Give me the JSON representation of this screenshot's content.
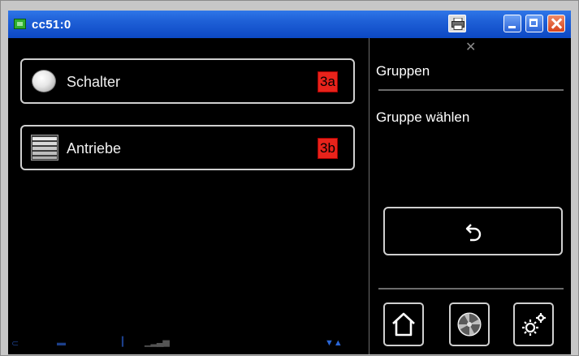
{
  "window": {
    "title": "cc51:0",
    "icons": {
      "app": "app-icon",
      "print": "print-icon",
      "minimize": "minimize-icon",
      "maximize": "maximize-icon",
      "close": "close-icon"
    }
  },
  "main": {
    "items": [
      {
        "label": "Schalter",
        "icon": "switch-icon",
        "tag": "3a"
      },
      {
        "label": "Antriebe",
        "icon": "blind-actuator-icon",
        "tag": "3b"
      }
    ]
  },
  "panel": {
    "title": "Gruppen",
    "subtitle": "Gruppe wählen",
    "buttons": {
      "back": "back-icon",
      "home": "home-icon",
      "fan": "fan-icon",
      "settings": "gear-icon"
    }
  },
  "colors": {
    "titlebar": "#1e5fd6",
    "background": "#000000",
    "tag": "#e8231b",
    "border": "#cfcfcf"
  }
}
